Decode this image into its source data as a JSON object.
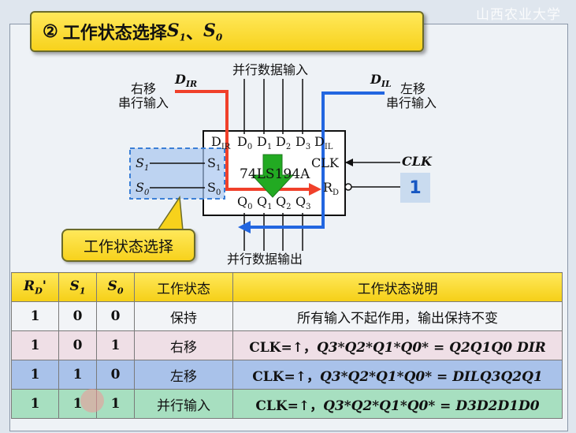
{
  "watermark": "山西农业大学",
  "title": {
    "index": "②",
    "text": "工作状态选择",
    "sym1": "S",
    "sub1": "1",
    "sep": "、",
    "sym2": "S",
    "sub2": "0"
  },
  "diagram": {
    "chip_name": "74LS194A",
    "parallel_in_label": "并行数据输入",
    "parallel_out_label": "并行数据输出",
    "shift_right_label_1": "右移",
    "shift_right_label_2": "串行输入",
    "shift_left_label_1": "左移",
    "shift_left_label_2": "串行输入",
    "dir_label": "D",
    "dir_sub": "IR",
    "dil_label": "D",
    "dil_sub": "IL",
    "clk_label": "CLK",
    "rd_value": "1",
    "mode_callout": "工作状态选择",
    "pins_top": [
      {
        "t": "D",
        "s": "IR"
      },
      {
        "t": "D",
        "s": "0"
      },
      {
        "t": "D",
        "s": "1"
      },
      {
        "t": "D",
        "s": "2"
      },
      {
        "t": "D",
        "s": "3"
      },
      {
        "t": "D",
        "s": "IL"
      }
    ],
    "pins_bottom": [
      {
        "t": "Q",
        "s": "0"
      },
      {
        "t": "Q",
        "s": "1"
      },
      {
        "t": "Q",
        "s": "2"
      },
      {
        "t": "Q",
        "s": "3"
      }
    ],
    "pin_s1": {
      "t": "S",
      "s": "1"
    },
    "pin_s0": {
      "t": "S",
      "s": "0"
    },
    "pin_clk": "CLK",
    "pin_rd": {
      "t": "R",
      "s": "D"
    },
    "ext_s1": {
      "t": "S",
      "s": "1"
    },
    "ext_s0": {
      "t": "S",
      "s": "0"
    },
    "colors": {
      "red_arrow": "#f0402a",
      "blue_arrow": "#2266e0",
      "green_arrow": "#22aa22",
      "select_box": "#3b7fd6"
    }
  },
  "table": {
    "headers": {
      "rd": "R",
      "rd_sub": "D",
      "rd_mark": "'",
      "s1": "S",
      "s1_sub": "1",
      "s0": "S",
      "s0_sub": "0",
      "state": "工作状态",
      "desc": "工作状态说明"
    },
    "rows": [
      {
        "rd": "1",
        "s1": "0",
        "s0": "0",
        "state": "保持",
        "desc": "所有输入不起作用，输出保持不变"
      },
      {
        "rd": "1",
        "s1": "0",
        "s0": "1",
        "state": "右移",
        "clk": "CLK=↑，",
        "lhs": "Q3*Q2*Q1*Q0* = ",
        "rhs": "Q2Q1Q0 DIR"
      },
      {
        "rd": "1",
        "s1": "1",
        "s0": "0",
        "state": "左移",
        "clk": "CLK=↑，",
        "lhs": "Q3*Q2*Q1*Q0* = ",
        "rhs": "DILQ3Q2Q1"
      },
      {
        "rd": "1",
        "s1": "1",
        "s0": "1",
        "state": "并行输入",
        "clk": "CLK=↑，",
        "lhs": "Q3*Q2*Q1*Q0* = ",
        "rhs": "D3D2D1D0"
      }
    ]
  }
}
